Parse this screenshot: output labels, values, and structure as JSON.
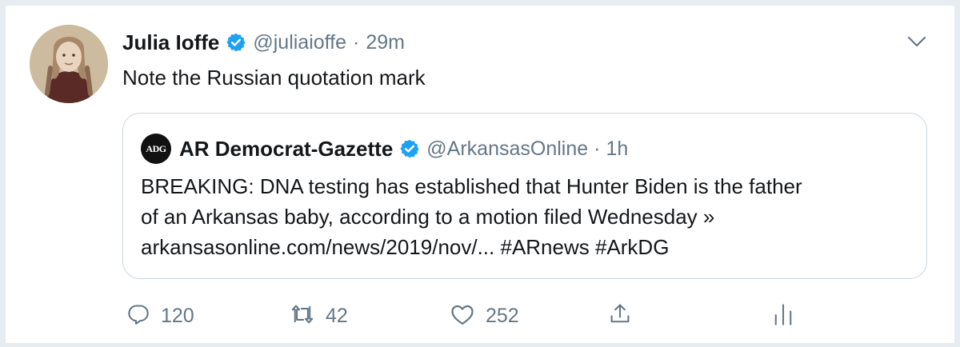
{
  "tweet": {
    "author_name": "Julia Ioffe",
    "handle": "@juliaioffe",
    "separator": "·",
    "time": "29m",
    "text": "Note the Russian quotation mark"
  },
  "quoted_tweet": {
    "logo_text": "ADG",
    "author_name": "AR Democrat-Gazette",
    "handle": "@ArkansasOnline",
    "separator": "·",
    "time": "1h",
    "text_lines": [
      "BREAKING: DNA testing has established that Hunter Biden is the father",
      "of an Arkansas baby, according to a motion filed Wednesday »",
      "arkansasonline.com/news/2019/nov/... #ARnews #ArkDG"
    ]
  },
  "actions": {
    "reply_count": "120",
    "retweet_count": "42",
    "like_count": "252"
  },
  "icons": {
    "verified": "verified-badge-icon",
    "more": "chevron-down-icon",
    "reply": "reply-icon",
    "retweet": "retweet-icon",
    "like": "heart-icon",
    "share": "share-icon",
    "analytics": "analytics-icon"
  },
  "colors": {
    "verified_blue": "#1da1f2",
    "text_primary": "#14171a",
    "text_secondary": "#657786",
    "border": "#ccd6dd"
  }
}
